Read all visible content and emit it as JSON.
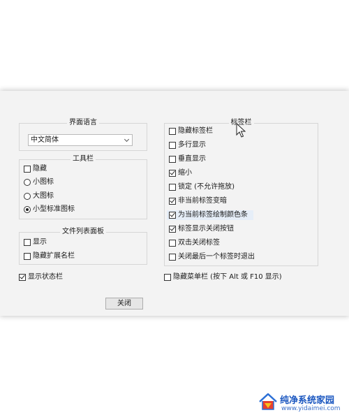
{
  "interface_language": {
    "legend": "界面语言",
    "selected": "中文简体"
  },
  "toolbar": {
    "legend": "工具栏",
    "hide": {
      "label": "隐藏",
      "checked": false
    },
    "icon_size_options": [
      {
        "label": "小图标",
        "checked": false
      },
      {
        "label": "大图标",
        "checked": false
      },
      {
        "label": "小型标准图标",
        "checked": true
      }
    ]
  },
  "file_list_panel": {
    "legend": "文件列表面板",
    "items": [
      {
        "label": "显示",
        "checked": false
      },
      {
        "label": "隐藏扩展名栏",
        "checked": false
      }
    ]
  },
  "show_status_bar": {
    "label": "显示状态栏",
    "checked": true
  },
  "tab_bar": {
    "legend": "标签栏",
    "items": [
      {
        "label": "隐藏标签栏",
        "checked": false
      },
      {
        "label": "多行显示",
        "checked": false
      },
      {
        "label": "垂直显示",
        "checked": false
      },
      {
        "label": "缩小",
        "checked": true
      },
      {
        "label": "锁定 (不允许拖放)",
        "checked": false
      },
      {
        "label": "非当前标签变暗",
        "checked": true
      },
      {
        "label": "为当前标签绘制颜色条",
        "checked": true
      },
      {
        "label": "标签显示关闭按钮",
        "checked": true
      },
      {
        "label": "双击关闭标签",
        "checked": false
      },
      {
        "label": "关闭最后一个标签时退出",
        "checked": false
      }
    ]
  },
  "hide_menu_bar": {
    "label": "隐藏菜单栏 (按下 Alt 或 F10 显示)",
    "checked": false
  },
  "close_button": {
    "label": "关闭"
  },
  "watermark": {
    "title": "纯净系统家园",
    "url": "www.yidaimei.com"
  }
}
